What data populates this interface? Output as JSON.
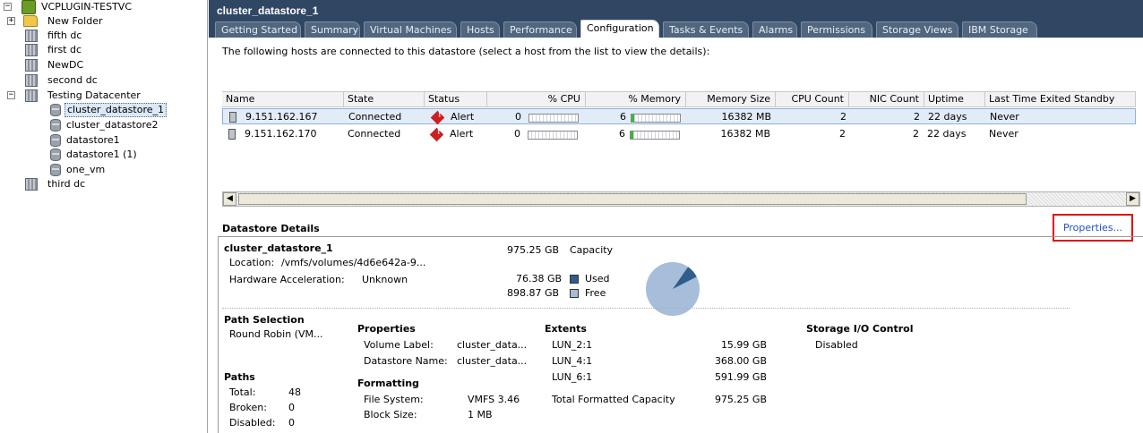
{
  "tree": {
    "root": "VCPLUGIN-TESTVC",
    "items": [
      {
        "label": "New Folder",
        "type": "folder"
      },
      {
        "label": "fifth dc",
        "type": "datacenter"
      },
      {
        "label": "first dc",
        "type": "datacenter"
      },
      {
        "label": "NewDC",
        "type": "datacenter"
      },
      {
        "label": "second dc",
        "type": "datacenter"
      },
      {
        "label": "Testing Datacenter",
        "type": "datacenter"
      },
      {
        "label": "cluster_datastore_1",
        "type": "datastore"
      },
      {
        "label": "cluster_datastore2",
        "type": "datastore"
      },
      {
        "label": "datastore1",
        "type": "datastore"
      },
      {
        "label": "datastore1 (1)",
        "type": "datastore"
      },
      {
        "label": "one_vm",
        "type": "datastore"
      },
      {
        "label": "third dc",
        "type": "datacenter"
      }
    ],
    "expander_plus": "+",
    "expander_minus": "−"
  },
  "header": {
    "title": "cluster_datastore_1",
    "tabs": [
      "Getting Started",
      "Summary",
      "Virtual Machines",
      "Hosts",
      "Performance",
      "Configuration",
      "Tasks & Events",
      "Alarms",
      "Permissions",
      "Storage Views",
      "IBM Storage"
    ],
    "active_tab": "Configuration"
  },
  "hosts": {
    "description": "The following hosts are connected to this datastore (select a host from the list to view the details):",
    "columns": [
      "Name",
      "State",
      "Status",
      "% CPU",
      "% Memory",
      "Memory Size",
      "CPU Count",
      "NIC Count",
      "Uptime",
      "Last Time Exited Standby"
    ],
    "rows": [
      {
        "name": "9.151.162.167",
        "state": "Connected",
        "status": "Alert",
        "cpu": "0",
        "cpu_pct": 0,
        "mem": "6",
        "mem_pct": 6,
        "memsize": "16382 MB",
        "cpucount": "2",
        "niccount": "2",
        "uptime": "22 days",
        "standby": "Never"
      },
      {
        "name": "9.151.162.170",
        "state": "Connected",
        "status": "Alert",
        "cpu": "0",
        "cpu_pct": 0,
        "mem": "6",
        "mem_pct": 6,
        "memsize": "16382 MB",
        "cpucount": "2",
        "niccount": "2",
        "uptime": "22 days",
        "standby": "Never"
      }
    ]
  },
  "details": {
    "heading": "Datastore Details",
    "properties_link": "Properties...",
    "name": "cluster_datastore_1",
    "location_label": "Location:",
    "location_value": "/vmfs/volumes/4d6e642a-9...",
    "hwaccel_label": "Hardware Acceleration:",
    "hwaccel_value": "Unknown",
    "capacity_value": "975.25 GB",
    "capacity_label": "Capacity",
    "used_value": "76.38 GB",
    "used_label": "Used",
    "free_value": "898.87 GB",
    "free_label": "Free",
    "used_fraction": 0.0783,
    "colors": {
      "used": "#2f5d8c",
      "free": "#a6bed9"
    },
    "path_selection_label": "Path Selection",
    "path_selection_value": "Round Robin (VM...",
    "paths_label": "Paths",
    "paths_total_label": "Total:",
    "paths_total": "48",
    "paths_broken_label": "Broken:",
    "paths_broken": "0",
    "paths_disabled_label": "Disabled:",
    "paths_disabled": "0",
    "properties_label": "Properties",
    "volume_label_label": "Volume Label:",
    "volume_label_value": "cluster_data...",
    "datastore_name_label": "Datastore Name:",
    "datastore_name_value": "cluster_data...",
    "formatting_label": "Formatting",
    "fs_label": "File System:",
    "fs_value": "VMFS 3.46",
    "bs_label": "Block Size:",
    "bs_value": "1 MB",
    "extents_label": "Extents",
    "extents": [
      {
        "name": "LUN_2:1",
        "size": "15.99 GB"
      },
      {
        "name": "LUN_4:1",
        "size": "368.00 GB"
      },
      {
        "name": "LUN_6:1",
        "size": "591.99 GB"
      }
    ],
    "total_formatted_label": "Total Formatted Capacity",
    "total_formatted_value": "975.25 GB",
    "sioc_label": "Storage I/O Control",
    "sioc_value": "Disabled"
  },
  "scroll": {
    "left_arrow": "◀",
    "right_arrow": "▶"
  }
}
